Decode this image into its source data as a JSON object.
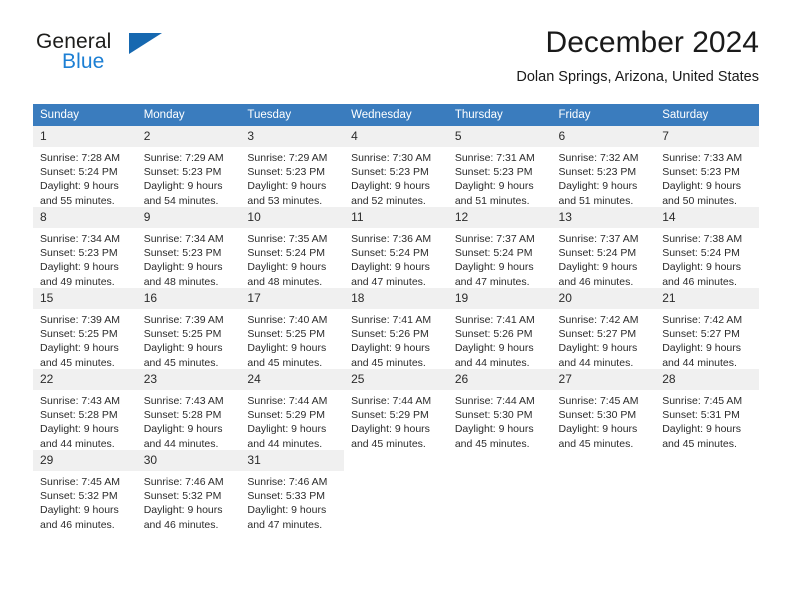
{
  "brand": {
    "name_part1": "General",
    "name_part2": "Blue",
    "logo_icon": "triangle-logo-icon",
    "accent_color": "#1c7fd4"
  },
  "header": {
    "title": "December 2024",
    "location": "Dolan Springs, Arizona, United States"
  },
  "calendar": {
    "header_color": "#3a7cbe",
    "daynum_background": "#f0f0f0",
    "weekday_headers": [
      "Sunday",
      "Monday",
      "Tuesday",
      "Wednesday",
      "Thursday",
      "Friday",
      "Saturday"
    ],
    "weeks": [
      [
        {
          "day": "1",
          "sunrise": "Sunrise: 7:28 AM",
          "sunset": "Sunset: 5:24 PM",
          "daylight_line1": "Daylight: 9 hours",
          "daylight_line2": "and 55 minutes."
        },
        {
          "day": "2",
          "sunrise": "Sunrise: 7:29 AM",
          "sunset": "Sunset: 5:23 PM",
          "daylight_line1": "Daylight: 9 hours",
          "daylight_line2": "and 54 minutes."
        },
        {
          "day": "3",
          "sunrise": "Sunrise: 7:29 AM",
          "sunset": "Sunset: 5:23 PM",
          "daylight_line1": "Daylight: 9 hours",
          "daylight_line2": "and 53 minutes."
        },
        {
          "day": "4",
          "sunrise": "Sunrise: 7:30 AM",
          "sunset": "Sunset: 5:23 PM",
          "daylight_line1": "Daylight: 9 hours",
          "daylight_line2": "and 52 minutes."
        },
        {
          "day": "5",
          "sunrise": "Sunrise: 7:31 AM",
          "sunset": "Sunset: 5:23 PM",
          "daylight_line1": "Daylight: 9 hours",
          "daylight_line2": "and 51 minutes."
        },
        {
          "day": "6",
          "sunrise": "Sunrise: 7:32 AM",
          "sunset": "Sunset: 5:23 PM",
          "daylight_line1": "Daylight: 9 hours",
          "daylight_line2": "and 51 minutes."
        },
        {
          "day": "7",
          "sunrise": "Sunrise: 7:33 AM",
          "sunset": "Sunset: 5:23 PM",
          "daylight_line1": "Daylight: 9 hours",
          "daylight_line2": "and 50 minutes."
        }
      ],
      [
        {
          "day": "8",
          "sunrise": "Sunrise: 7:34 AM",
          "sunset": "Sunset: 5:23 PM",
          "daylight_line1": "Daylight: 9 hours",
          "daylight_line2": "and 49 minutes."
        },
        {
          "day": "9",
          "sunrise": "Sunrise: 7:34 AM",
          "sunset": "Sunset: 5:23 PM",
          "daylight_line1": "Daylight: 9 hours",
          "daylight_line2": "and 48 minutes."
        },
        {
          "day": "10",
          "sunrise": "Sunrise: 7:35 AM",
          "sunset": "Sunset: 5:24 PM",
          "daylight_line1": "Daylight: 9 hours",
          "daylight_line2": "and 48 minutes."
        },
        {
          "day": "11",
          "sunrise": "Sunrise: 7:36 AM",
          "sunset": "Sunset: 5:24 PM",
          "daylight_line1": "Daylight: 9 hours",
          "daylight_line2": "and 47 minutes."
        },
        {
          "day": "12",
          "sunrise": "Sunrise: 7:37 AM",
          "sunset": "Sunset: 5:24 PM",
          "daylight_line1": "Daylight: 9 hours",
          "daylight_line2": "and 47 minutes."
        },
        {
          "day": "13",
          "sunrise": "Sunrise: 7:37 AM",
          "sunset": "Sunset: 5:24 PM",
          "daylight_line1": "Daylight: 9 hours",
          "daylight_line2": "and 46 minutes."
        },
        {
          "day": "14",
          "sunrise": "Sunrise: 7:38 AM",
          "sunset": "Sunset: 5:24 PM",
          "daylight_line1": "Daylight: 9 hours",
          "daylight_line2": "and 46 minutes."
        }
      ],
      [
        {
          "day": "15",
          "sunrise": "Sunrise: 7:39 AM",
          "sunset": "Sunset: 5:25 PM",
          "daylight_line1": "Daylight: 9 hours",
          "daylight_line2": "and 45 minutes."
        },
        {
          "day": "16",
          "sunrise": "Sunrise: 7:39 AM",
          "sunset": "Sunset: 5:25 PM",
          "daylight_line1": "Daylight: 9 hours",
          "daylight_line2": "and 45 minutes."
        },
        {
          "day": "17",
          "sunrise": "Sunrise: 7:40 AM",
          "sunset": "Sunset: 5:25 PM",
          "daylight_line1": "Daylight: 9 hours",
          "daylight_line2": "and 45 minutes."
        },
        {
          "day": "18",
          "sunrise": "Sunrise: 7:41 AM",
          "sunset": "Sunset: 5:26 PM",
          "daylight_line1": "Daylight: 9 hours",
          "daylight_line2": "and 45 minutes."
        },
        {
          "day": "19",
          "sunrise": "Sunrise: 7:41 AM",
          "sunset": "Sunset: 5:26 PM",
          "daylight_line1": "Daylight: 9 hours",
          "daylight_line2": "and 44 minutes."
        },
        {
          "day": "20",
          "sunrise": "Sunrise: 7:42 AM",
          "sunset": "Sunset: 5:27 PM",
          "daylight_line1": "Daylight: 9 hours",
          "daylight_line2": "and 44 minutes."
        },
        {
          "day": "21",
          "sunrise": "Sunrise: 7:42 AM",
          "sunset": "Sunset: 5:27 PM",
          "daylight_line1": "Daylight: 9 hours",
          "daylight_line2": "and 44 minutes."
        }
      ],
      [
        {
          "day": "22",
          "sunrise": "Sunrise: 7:43 AM",
          "sunset": "Sunset: 5:28 PM",
          "daylight_line1": "Daylight: 9 hours",
          "daylight_line2": "and 44 minutes."
        },
        {
          "day": "23",
          "sunrise": "Sunrise: 7:43 AM",
          "sunset": "Sunset: 5:28 PM",
          "daylight_line1": "Daylight: 9 hours",
          "daylight_line2": "and 44 minutes."
        },
        {
          "day": "24",
          "sunrise": "Sunrise: 7:44 AM",
          "sunset": "Sunset: 5:29 PM",
          "daylight_line1": "Daylight: 9 hours",
          "daylight_line2": "and 44 minutes."
        },
        {
          "day": "25",
          "sunrise": "Sunrise: 7:44 AM",
          "sunset": "Sunset: 5:29 PM",
          "daylight_line1": "Daylight: 9 hours",
          "daylight_line2": "and 45 minutes."
        },
        {
          "day": "26",
          "sunrise": "Sunrise: 7:44 AM",
          "sunset": "Sunset: 5:30 PM",
          "daylight_line1": "Daylight: 9 hours",
          "daylight_line2": "and 45 minutes."
        },
        {
          "day": "27",
          "sunrise": "Sunrise: 7:45 AM",
          "sunset": "Sunset: 5:30 PM",
          "daylight_line1": "Daylight: 9 hours",
          "daylight_line2": "and 45 minutes."
        },
        {
          "day": "28",
          "sunrise": "Sunrise: 7:45 AM",
          "sunset": "Sunset: 5:31 PM",
          "daylight_line1": "Daylight: 9 hours",
          "daylight_line2": "and 45 minutes."
        }
      ],
      [
        {
          "day": "29",
          "sunrise": "Sunrise: 7:45 AM",
          "sunset": "Sunset: 5:32 PM",
          "daylight_line1": "Daylight: 9 hours",
          "daylight_line2": "and 46 minutes."
        },
        {
          "day": "30",
          "sunrise": "Sunrise: 7:46 AM",
          "sunset": "Sunset: 5:32 PM",
          "daylight_line1": "Daylight: 9 hours",
          "daylight_line2": "and 46 minutes."
        },
        {
          "day": "31",
          "sunrise": "Sunrise: 7:46 AM",
          "sunset": "Sunset: 5:33 PM",
          "daylight_line1": "Daylight: 9 hours",
          "daylight_line2": "and 47 minutes."
        },
        {
          "day": "",
          "sunrise": "",
          "sunset": "",
          "daylight_line1": "",
          "daylight_line2": ""
        },
        {
          "day": "",
          "sunrise": "",
          "sunset": "",
          "daylight_line1": "",
          "daylight_line2": ""
        },
        {
          "day": "",
          "sunrise": "",
          "sunset": "",
          "daylight_line1": "",
          "daylight_line2": ""
        },
        {
          "day": "",
          "sunrise": "",
          "sunset": "",
          "daylight_line1": "",
          "daylight_line2": ""
        }
      ]
    ]
  }
}
